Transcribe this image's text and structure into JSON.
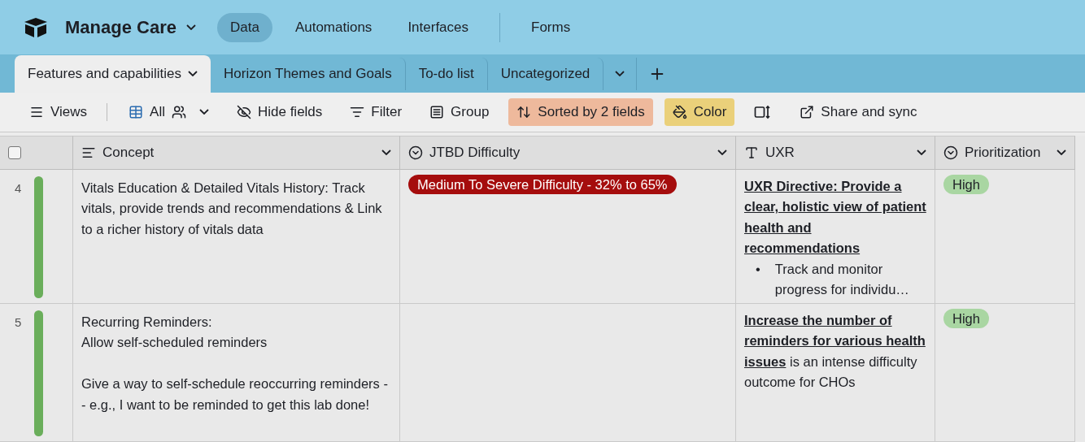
{
  "app": {
    "title": "Manage Care"
  },
  "nav": [
    {
      "label": "Data",
      "selected": true
    },
    {
      "label": "Automations",
      "selected": false
    },
    {
      "label": "Interfaces",
      "selected": false
    },
    {
      "label": "Forms",
      "selected": false
    }
  ],
  "tables": [
    {
      "label": "Features and capabilities",
      "selected": true
    },
    {
      "label": "Horizon Themes and Goals",
      "selected": false
    },
    {
      "label": "To-do list",
      "selected": false
    },
    {
      "label": "Uncategorized",
      "selected": false
    }
  ],
  "toolbar": [
    {
      "kind": "views",
      "label": "Views",
      "active": false
    },
    {
      "kind": "view",
      "label": "All",
      "active": false
    },
    {
      "kind": "hide",
      "label": "Hide fields",
      "active": false
    },
    {
      "kind": "filter",
      "label": "Filter",
      "active": false
    },
    {
      "kind": "group",
      "label": "Group",
      "active": false
    },
    {
      "kind": "sort",
      "label": "Sorted by 2 fields",
      "active": true
    },
    {
      "kind": "color",
      "label": "Color",
      "active": true
    },
    {
      "kind": "height",
      "active": false
    },
    {
      "kind": "share",
      "label": "Share and sync",
      "active": false
    }
  ],
  "table": {
    "select_all": {
      "checked": false
    },
    "columns": [
      {
        "kind": "longtext",
        "label": "Concept"
      },
      {
        "kind": "select",
        "label": "JTBD Difficulty"
      },
      {
        "kind": "text",
        "label": "UXR"
      },
      {
        "kind": "select",
        "label": "Prioritization"
      }
    ],
    "rows": [
      {
        "number": "4",
        "color": "#6aae5b",
        "concept": "Vitals Education & Detailed Vitals History: Track vitals, provide trends and recommendations & Link to a richer history of vitals data",
        "difficulty": "Medium To Severe Difficulty - 32% to 65%",
        "uxr": {
          "heading": "UXR Directive: Provide a clear, holistic view of patient health and recommendations",
          "bullets": [
            {
              "marker": "•",
              "text": "Track and monitor progress for individu…"
            }
          ]
        },
        "priority": "High"
      },
      {
        "number": "5",
        "color": "#6aae5b",
        "concept": "Recurring Reminders:\nAllow self-scheduled reminders\n\nGive a way to self-schedule reoccurring reminders -- e.g., I want to be reminded to get this lab done!",
        "uxr": {
          "text": "**Increase the number of reminders for various health issues** is an intense difficulty outcome for CHOs"
        },
        "priority": "High"
      }
    ]
  }
}
